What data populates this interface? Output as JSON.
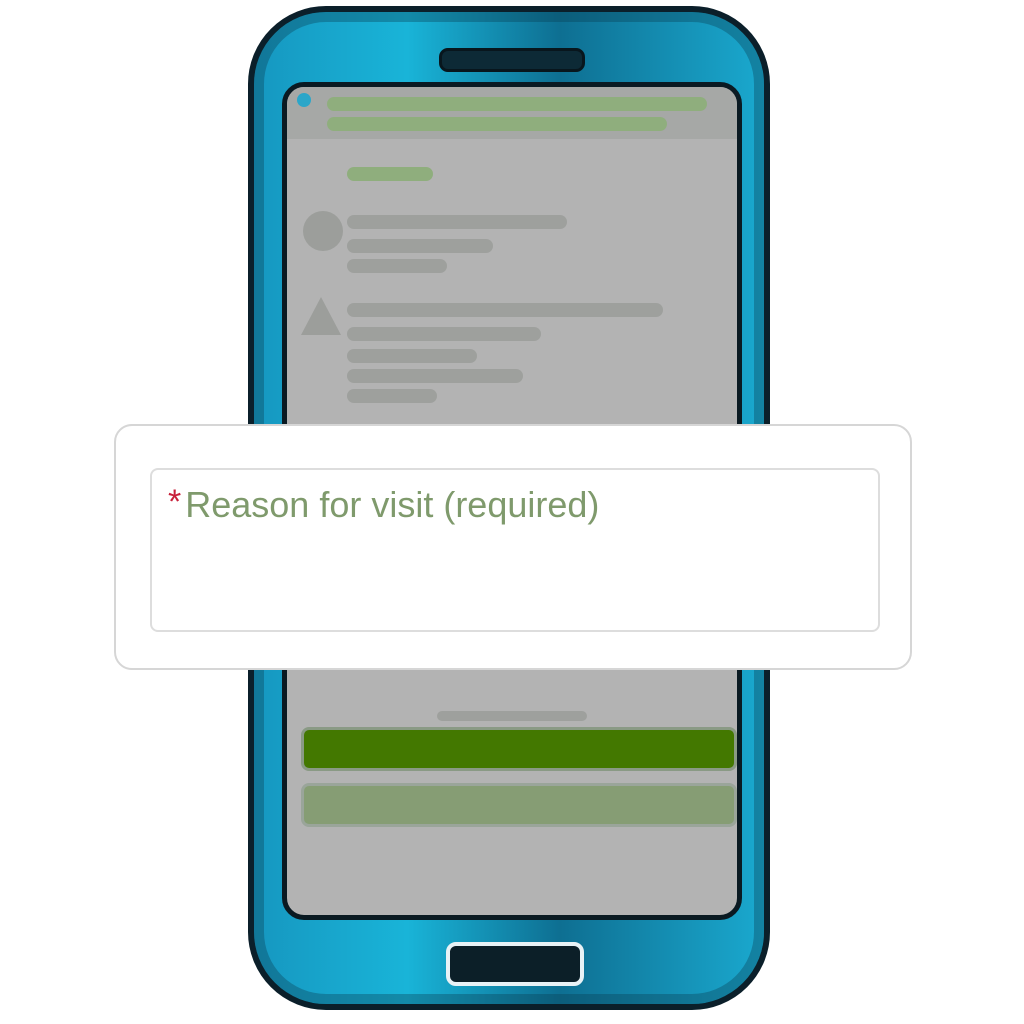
{
  "form": {
    "reason_field": {
      "required_marker": "*",
      "placeholder": "Reason for visit (required)",
      "value": ""
    }
  },
  "colors": {
    "phone_body": "#19b4d8",
    "screen_background": "#b3b3b3",
    "primary_button": "#437800",
    "secondary_button": "#869d74",
    "required_marker": "#c8203a",
    "placeholder_text": "#7f9a6c"
  },
  "icons": {
    "topbar": "app-indicator-icon",
    "avatar_first": "person-avatar-icon",
    "avatar_second": "warning-triangle-icon"
  }
}
